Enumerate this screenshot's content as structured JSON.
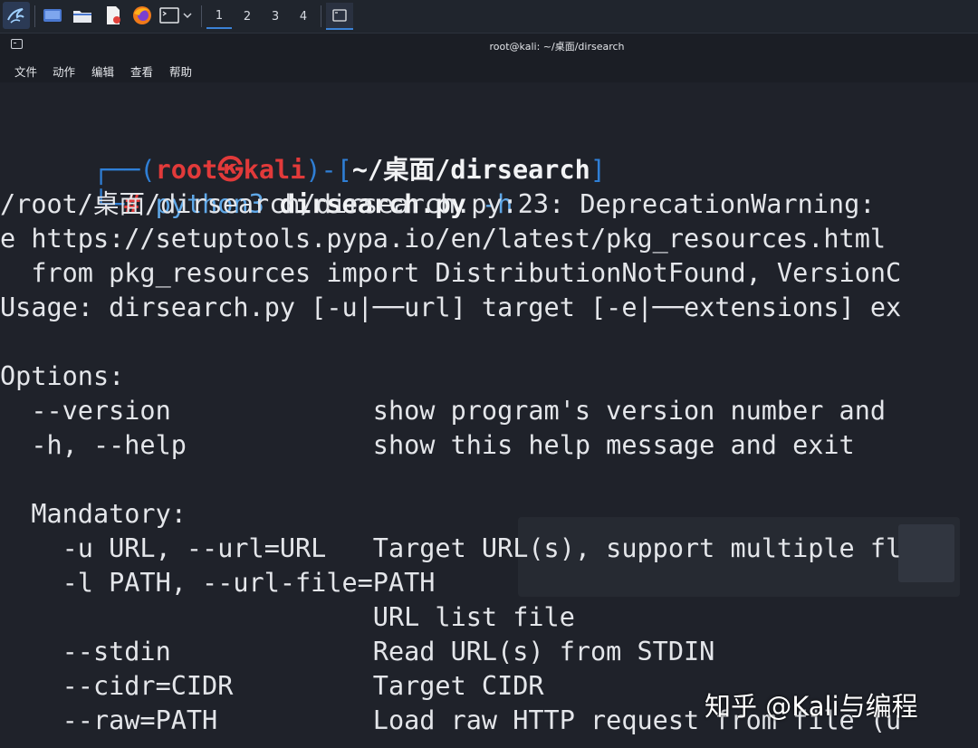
{
  "taskbar": {
    "workspaces": [
      "1",
      "2",
      "3",
      "4"
    ]
  },
  "window": {
    "title": "root@kali: ~/桌面/dirsearch"
  },
  "menu": [
    "文件",
    "动作",
    "编辑",
    "查看",
    "帮助"
  ],
  "prompt": {
    "corner_top": "┌──(",
    "user": "root㉿kali",
    "middle": ")-[",
    "path": "~/桌面/dirsearch",
    "close": "]",
    "corner_bottom": "└─",
    "hash": "#",
    "command_prog": "python3",
    "command_script": "dirsearch.py",
    "command_flag": "-h"
  },
  "output": [
    "/root/桌面/dirsearch/dirsearch.py:23: DeprecationWarning: ",
    "e https://setuptools.pypa.io/en/latest/pkg_resources.html",
    "  from pkg_resources import DistributionNotFound, VersionC",
    "Usage: dirsearch.py [-u|──url] target [-e|──extensions] ex",
    "",
    "Options:",
    "  --version             show program's version number and",
    "  -h, --help            show this help message and exit",
    "",
    "  Mandatory:",
    "    -u URL, --url=URL   Target URL(s), support multiple fl",
    "    -l PATH, --url-file=PATH",
    "                        URL list file",
    "    --stdin             Read URL(s) from STDIN",
    "    --cidr=CIDR         Target CIDR",
    "    --raw=PATH          Load raw HTTP request from file (u"
  ],
  "watermark": {
    "zhihu": "知乎 @Kali与编程"
  },
  "colors": {
    "background": "#1f222a",
    "prompt_blue": "#2f7fd6",
    "prompt_red": "#e23a3a",
    "accent": "#3b82d6"
  },
  "icons": [
    "kali-logo-icon",
    "desktop-icon",
    "file-manager-icon",
    "text-editor-icon",
    "firefox-icon",
    "terminal-icon",
    "chevron-down-icon"
  ]
}
